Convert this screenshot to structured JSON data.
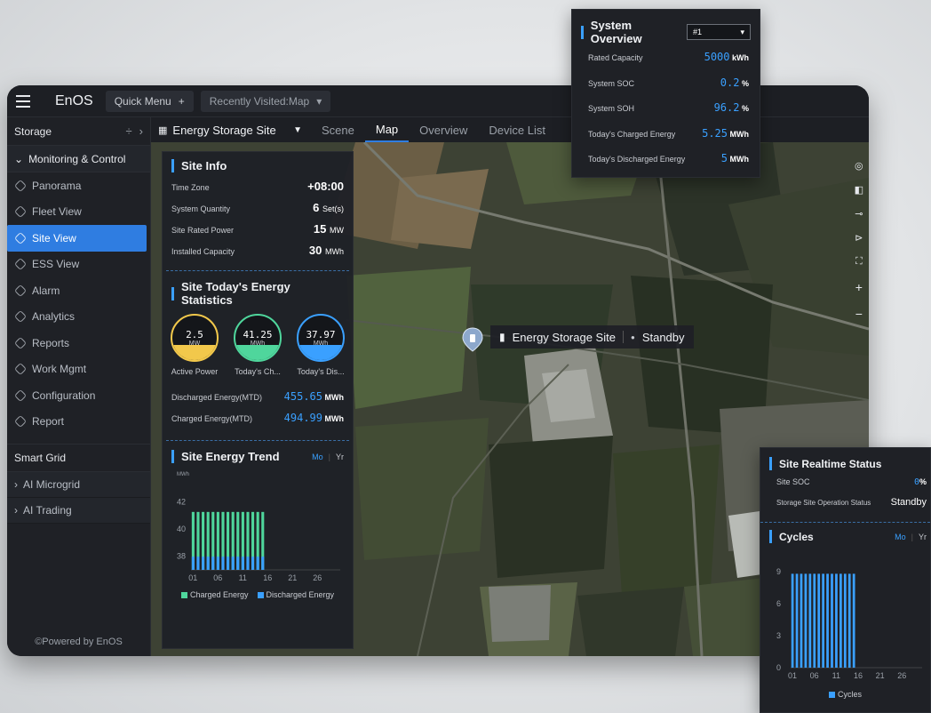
{
  "topbar": {
    "brand": "EnOS",
    "quick_menu": "Quick Menu",
    "recent": "Recently Visited:Map"
  },
  "sidebar": {
    "header": "Storage",
    "section": "Monitoring & Control",
    "items": [
      {
        "label": "Panorama"
      },
      {
        "label": "Fleet View"
      },
      {
        "label": "Site View"
      },
      {
        "label": "ESS View"
      },
      {
        "label": "Alarm"
      },
      {
        "label": "Analytics"
      },
      {
        "label": "Reports"
      },
      {
        "label": "Work Mgmt"
      },
      {
        "label": "Configuration"
      },
      {
        "label": "Report"
      }
    ],
    "active_index": 2,
    "smart_grid": "Smart Grid",
    "sub_items": [
      {
        "label": "AI Microgrid"
      },
      {
        "label": "AI Trading"
      }
    ],
    "powered": "©Powered by EnOS"
  },
  "nav": {
    "site_name": "Energy Storage Site",
    "tabs": [
      {
        "label": "Scene"
      },
      {
        "label": "Map"
      },
      {
        "label": "Overview"
      },
      {
        "label": "Device List"
      }
    ],
    "active_tab": 1
  },
  "site_info": {
    "title": "Site Info",
    "rows": [
      {
        "label": "Time Zone",
        "value": "+08:00",
        "unit": ""
      },
      {
        "label": "System Quantity",
        "value": "6",
        "unit": "Set(s)"
      },
      {
        "label": "Site Rated Power",
        "value": "15",
        "unit": "MW"
      },
      {
        "label": "Installed Capacity",
        "value": "30",
        "unit": "MWh"
      }
    ]
  },
  "energy_stats": {
    "title": "Site Today's Energy Statistics",
    "gauges": [
      {
        "value": "2.5",
        "unit": "MW",
        "label": "Active Power",
        "color": "#f2c84b",
        "fill": 0.35
      },
      {
        "value": "41.25",
        "unit": "MWh",
        "label": "Today's Ch...",
        "color": "#4fd69c",
        "fill": 0.35
      },
      {
        "value": "37.97",
        "unit": "MWh",
        "label": "Today's Dis...",
        "color": "#3aa0ff",
        "fill": 0.35
      }
    ],
    "mtd": [
      {
        "label": "Discharged Energy(MTD)",
        "value": "455.65",
        "unit": "MWh"
      },
      {
        "label": "Charged Energy(MTD)",
        "value": "494.99",
        "unit": "MWh"
      }
    ]
  },
  "trend": {
    "title": "Site Energy Trend",
    "mo": "Mo",
    "yr": "Yr",
    "unit_label": "MWh",
    "legend": [
      {
        "label": "Charged Energy",
        "color": "#4fd69c"
      },
      {
        "label": "Discharged Energy",
        "color": "#3aa0ff"
      }
    ]
  },
  "chart_data": [
    {
      "type": "bar",
      "ylabel": "MWh",
      "ylim": [
        37,
        43
      ],
      "yticks": [
        "42",
        "40",
        "38"
      ],
      "xticks": [
        "01",
        "06",
        "11",
        "16",
        "21",
        "26"
      ],
      "categories": [
        "01",
        "02",
        "03",
        "04",
        "05",
        "06",
        "07",
        "08",
        "09",
        "10",
        "11",
        "12",
        "13",
        "14",
        "15",
        "16",
        "17",
        "18",
        "19",
        "20",
        "21",
        "22",
        "23",
        "24",
        "25",
        "26",
        "27",
        "28",
        "29",
        "30"
      ],
      "series": [
        {
          "name": "Charged Energy",
          "values": [
            41.25,
            41.25,
            41.25,
            41.25,
            41.25,
            41.25,
            41.25,
            41.25,
            41.25,
            41.25,
            41.25,
            41.25,
            41.25,
            41.25,
            41.25,
            null,
            null,
            null,
            null,
            null,
            null,
            null,
            null,
            null,
            null,
            null,
            null,
            null,
            null,
            null
          ]
        },
        {
          "name": "Discharged Energy",
          "values": [
            37.97,
            37.97,
            37.97,
            37.97,
            37.97,
            37.97,
            37.97,
            37.97,
            37.97,
            37.97,
            37.97,
            37.97,
            37.97,
            37.97,
            37.97,
            null,
            null,
            null,
            null,
            null,
            null,
            null,
            null,
            null,
            null,
            null,
            null,
            null,
            null,
            null
          ]
        }
      ]
    },
    {
      "type": "bar",
      "ylim": [
        0,
        10
      ],
      "yticks": [
        "9",
        "6",
        "3",
        "0"
      ],
      "xticks": [
        "01",
        "06",
        "11",
        "16",
        "21",
        "26"
      ],
      "categories": [
        "01",
        "02",
        "03",
        "04",
        "05",
        "06",
        "07",
        "08",
        "09",
        "10",
        "11",
        "12",
        "13",
        "14",
        "15",
        "16",
        "17",
        "18",
        "19",
        "20",
        "21",
        "22",
        "23",
        "24",
        "25",
        "26",
        "27",
        "28",
        "29",
        "30"
      ],
      "series": [
        {
          "name": "Cycles",
          "values": [
            8.8,
            8.8,
            8.8,
            8.8,
            8.8,
            8.8,
            8.8,
            8.8,
            8.8,
            8.8,
            8.8,
            8.8,
            8.8,
            8.8,
            8.8,
            null,
            null,
            null,
            null,
            null,
            null,
            null,
            null,
            null,
            null,
            null,
            null,
            null,
            null,
            null
          ]
        }
      ]
    }
  ],
  "overview": {
    "title": "System Overview",
    "selected": "#1",
    "rows": [
      {
        "label": "Rated Capacity",
        "value": "5000",
        "unit": "kWh"
      },
      {
        "label": "System SOC",
        "value": "0.2",
        "unit": "%"
      },
      {
        "label": "System SOH",
        "value": "96.2",
        "unit": "%"
      },
      {
        "label": "Today's Charged Energy",
        "value": "5.25",
        "unit": "MWh"
      },
      {
        "label": "Today's Discharged Energy",
        "value": "5",
        "unit": "MWh"
      }
    ]
  },
  "callout": {
    "site": "Energy Storage Site",
    "status": "Standby"
  },
  "realtime": {
    "title": "Site Realtime Status",
    "soc_label": "Site SOC",
    "soc_value": "0",
    "soc_unit": "%",
    "op_label": "Storage Site Operation Status",
    "op_value": "Standby",
    "cycles_title": "Cycles",
    "mo": "Mo",
    "yr": "Yr",
    "legend": "Cycles"
  }
}
